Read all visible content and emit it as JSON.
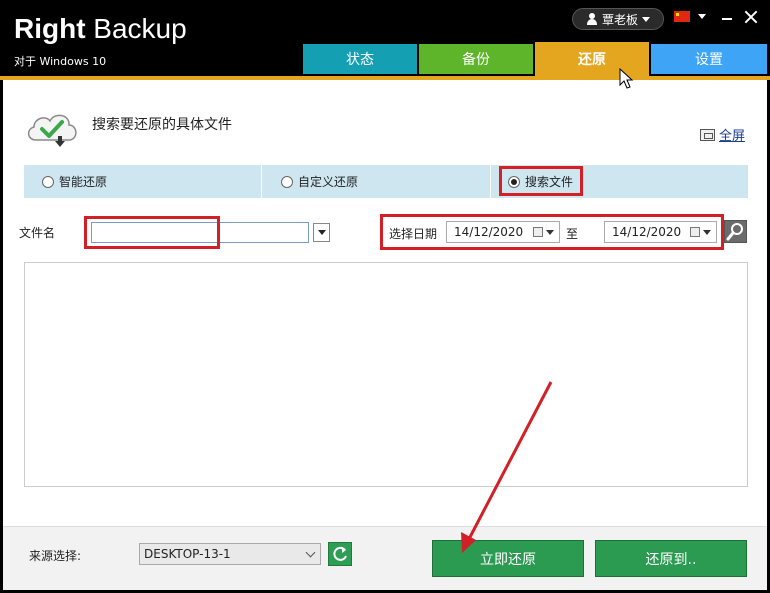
{
  "app": {
    "brand_bold": "Right",
    "brand_light": " Backup",
    "subtitle": "对于 Windows 10"
  },
  "user": {
    "name": "覃老板"
  },
  "tabs": [
    {
      "label": "状态",
      "color": "#159fb3"
    },
    {
      "label": "备份",
      "color": "#5fb529"
    },
    {
      "label": "还原",
      "color": "#e4a51f",
      "active": true
    },
    {
      "label": "设置",
      "color": "#3ea4f5"
    }
  ],
  "header": {
    "title": "搜索要还原的具体文件",
    "fullscreen_label": "全屏"
  },
  "modes": [
    {
      "label": "智能还原",
      "selected": false
    },
    {
      "label": "自定义还原",
      "selected": false
    },
    {
      "label": "搜索文件",
      "selected": true
    }
  ],
  "search": {
    "filename_label": "文件名",
    "filename_value": "",
    "date_label": "选择日期",
    "date_from": "14/12/2020",
    "to_label": "至",
    "date_to": "14/12/2020"
  },
  "footer": {
    "source_label": "来源选择:",
    "source_value": "DESKTOP-13-1",
    "restore_now_label": "立即还原",
    "restore_to_label": "还原到.."
  },
  "colors": {
    "accent": "#e4a51f",
    "highlight_red": "#d31f26",
    "button_green": "#2c9b52"
  }
}
